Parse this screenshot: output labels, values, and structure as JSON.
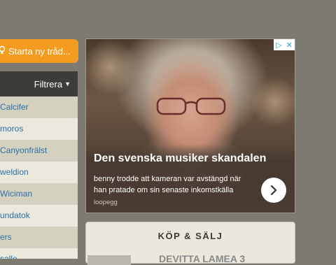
{
  "start_thread": {
    "label": "Starta ny tråd..."
  },
  "sidebar": {
    "filter_label": "Filtrera",
    "users": [
      "Calcifer",
      "moros",
      "Canyonfrälst",
      "weldion",
      "Wiciman",
      "undatok",
      "ers",
      "salle"
    ]
  },
  "ad": {
    "headline": "Den svenska musiker skandalen",
    "body": "benny trodde att kameran var avstängd när han pratade om sin senaste inkomstkälla",
    "source": "loopegg"
  },
  "buy_sell": {
    "title": "KÖP & SÄLJ",
    "item_partial": "DEVITTA LAMEA 3"
  },
  "colors": {
    "background": "#7d7a72",
    "accent": "#f39c1f",
    "link": "#2e6fa8",
    "filter_bar": "#3d3c36"
  }
}
